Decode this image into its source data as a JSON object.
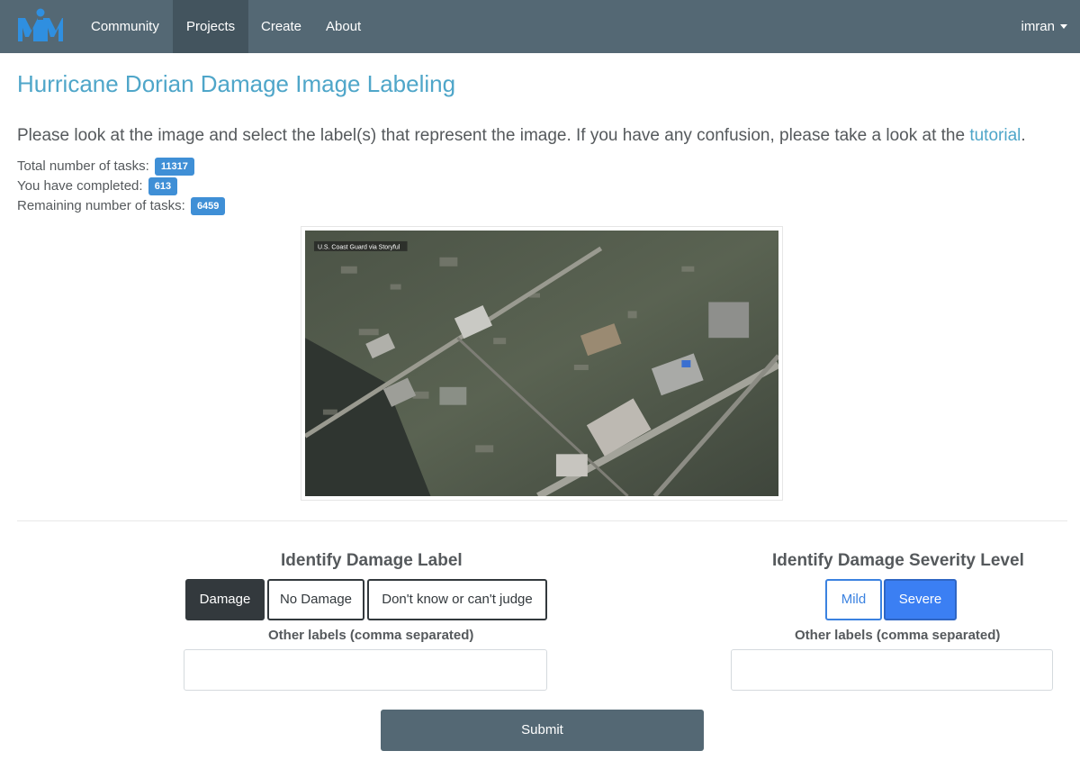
{
  "nav": {
    "logo_text": "MM",
    "items": [
      {
        "label": "Community"
      },
      {
        "label": "Projects"
      },
      {
        "label": "Create"
      },
      {
        "label": "About"
      }
    ],
    "user": "imran"
  },
  "page": {
    "title": "Hurricane Dorian Damage Image Labeling",
    "instructions": "Please look at the image and select the label(s) that represent the image. If you have any confusion, please take a look at the",
    "tutorial_link": "tutorial",
    "instructions_end": "."
  },
  "stats": {
    "total_label": "Total number of tasks:",
    "total_value": "11317",
    "completed_label": "You have completed:",
    "completed_value": "613",
    "remaining_label": "Remaining number of tasks:",
    "remaining_value": "6459"
  },
  "image": {
    "caption": "U.S. Coast Guard via Storyful"
  },
  "damage_section": {
    "title": "Identify Damage Label",
    "buttons": [
      {
        "label": "Damage",
        "selected": true
      },
      {
        "label": "No Damage",
        "selected": false
      },
      {
        "label": "Don't know or can't judge",
        "selected": false
      }
    ],
    "other_label": "Other labels (comma separated)",
    "other_value": ""
  },
  "severity_section": {
    "title": "Identify Damage Severity Level",
    "buttons": [
      {
        "label": "Mild",
        "selected": false
      },
      {
        "label": "Severe",
        "selected": true
      }
    ],
    "other_label": "Other labels (comma separated)",
    "other_value": ""
  },
  "submit_label": "Submit",
  "colors": {
    "navbar": "#546874",
    "accent": "#4fa6c9",
    "badge": "#3f8fd6",
    "selected_dark": "#33393d",
    "severity_blue": "#3b7ff3"
  }
}
